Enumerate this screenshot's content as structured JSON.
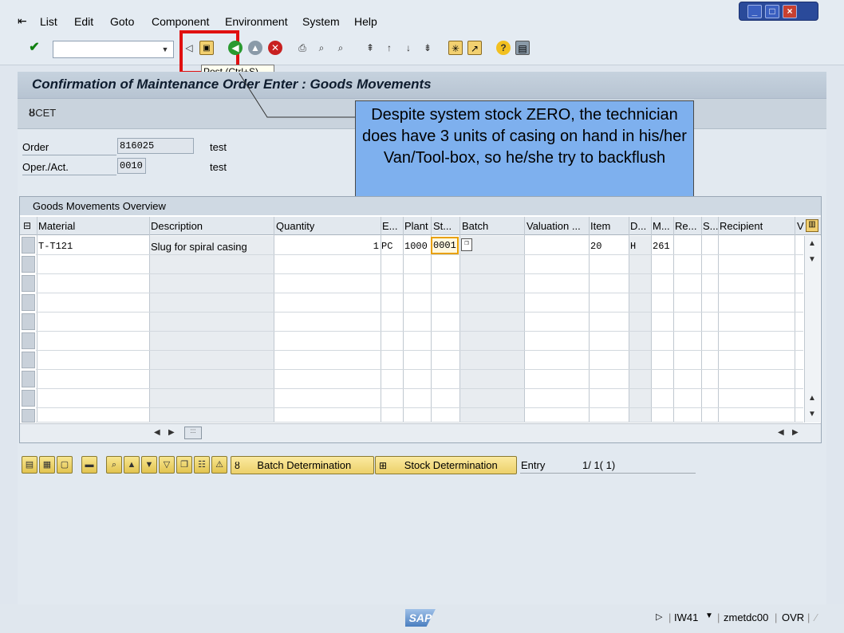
{
  "menu": {
    "items": [
      {
        "label": "List",
        "accel": "L"
      },
      {
        "label": "Edit",
        "accel": "E"
      },
      {
        "label": "Goto",
        "accel": "G"
      },
      {
        "label": "Component",
        "accel": "C"
      },
      {
        "label": "Environment",
        "accel": "n"
      },
      {
        "label": "System",
        "accel": "y"
      },
      {
        "label": "Help",
        "accel": "H"
      }
    ]
  },
  "toolbar": {
    "command_value": "",
    "tooltip": "Post   (Ctrl+S)"
  },
  "screen": {
    "title": "Confirmation of Maintenance Order Enter : Goods Movements",
    "app_button": "CET"
  },
  "header": {
    "order_label": "Order",
    "order_value": "816025",
    "order_text": "test",
    "operation_label": "Oper./Act.",
    "operation_value": "0010",
    "operation_text": "test"
  },
  "callout": {
    "text": "Despite system stock ZERO, the technician does have 3 units of casing on hand in his/her Van/Tool-box, so he/she try to backflush"
  },
  "table": {
    "title": "Goods Movements Overview",
    "columns": [
      "Material",
      "Description",
      "Quantity",
      "E...",
      "Plant",
      "St...",
      "Batch",
      "Valuation ...",
      "Item",
      "D...",
      "M...",
      "Re...",
      "S...",
      "Recipient",
      "V"
    ],
    "rows": [
      {
        "material": "T-T121",
        "description": "Slug for spiral casing",
        "quantity": "1",
        "unit": "PC",
        "plant": "1000",
        "storage": "0001",
        "batch": "",
        "valuation": "",
        "item": "20",
        "debit_credit": "H",
        "movement": "261"
      }
    ]
  },
  "buttons": {
    "batch_determination": "Batch Determination",
    "stock_determination": "Stock Determination"
  },
  "entry": {
    "label": "Entry",
    "count": "1/ 1( 1)"
  },
  "status": {
    "logo": "SAP",
    "transaction": "IW41",
    "server": "zmetdc00",
    "mode": "OVR"
  },
  "colors": {
    "callout": "#7eb0ee",
    "highlight": "#e01010",
    "title_bg": "#c6d2de"
  }
}
